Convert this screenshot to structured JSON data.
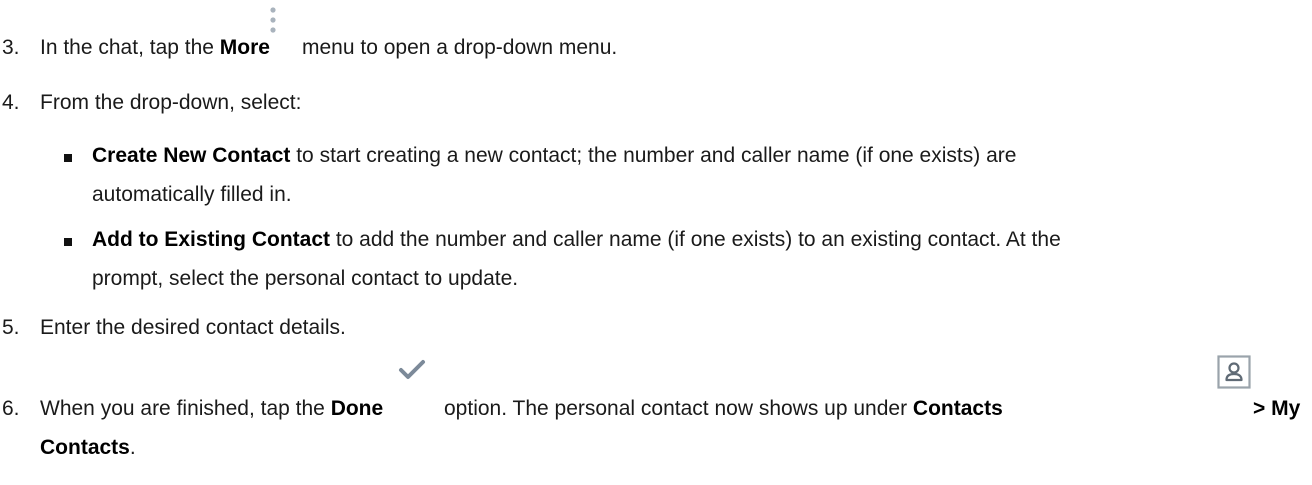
{
  "steps": [
    {
      "number": "3.",
      "pre": "In the chat, tap the ",
      "bold": "More",
      "post": " menu to open a drop-down menu.",
      "icon": "vertical-ellipsis-icon"
    },
    {
      "number": "4.",
      "text": "From the drop-down, select:",
      "bullets": [
        {
          "bold": "Create New Contact",
          "line1": " to start creating a new contact; the number and caller name (if one exists) are",
          "line2": "automatically filled in."
        },
        {
          "bold": "Add to Existing Contact",
          "line1": " to add the number and caller name (if one exists) to an existing contact. At the",
          "line2": "prompt, select the personal contact to update."
        }
      ]
    },
    {
      "number": "5.",
      "text": "Enter the desired contact details."
    },
    {
      "number": "6.",
      "pre": "When you are finished, tap the ",
      "bold": "Done",
      "mid": " option. The personal contact now shows up under ",
      "bold2": "Contacts",
      "post": " > My",
      "line2_bold": "Contacts",
      "line2_post": ".",
      "icons": [
        "checkmark-icon",
        "contacts-icon"
      ]
    }
  ],
  "colors": {
    "text": "#1a1a1a",
    "icon_gray": "#a9b3bd",
    "check": "#7c8a99"
  }
}
